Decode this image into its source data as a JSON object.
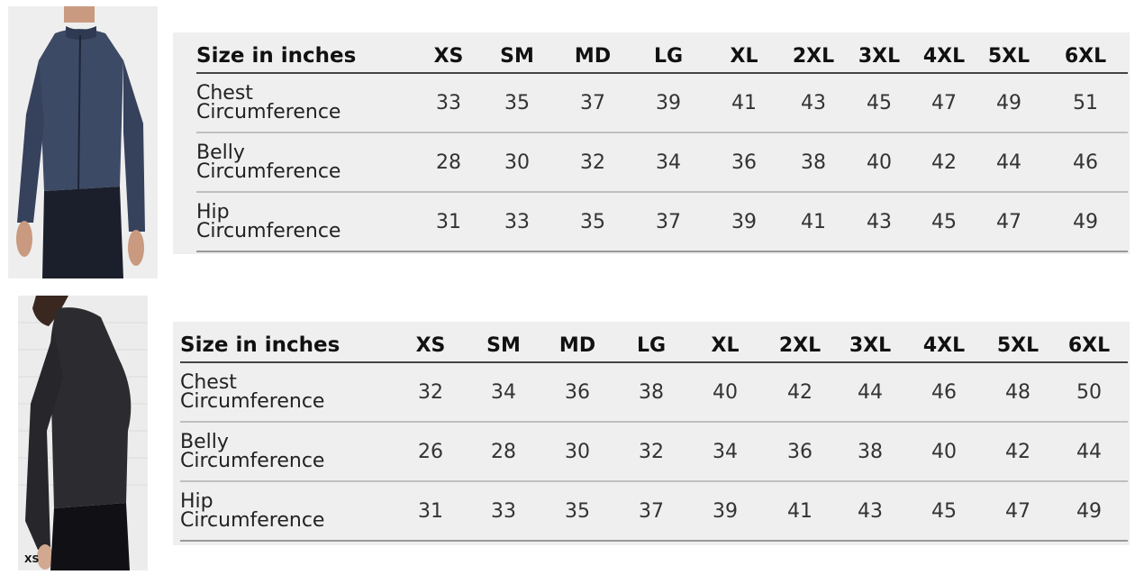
{
  "men_chart": {
    "photo": {
      "name": "mens-long-sleeve-jersey"
    },
    "header": {
      "label": "Size in inches",
      "sizes": [
        "XS",
        "SM",
        "MD",
        "LG",
        "XL",
        "2XL",
        "3XL",
        "4XL",
        "5XL",
        "6XL"
      ]
    },
    "rows": [
      {
        "label_line1": "Chest",
        "label_line2": "Circumference",
        "values": [
          "33",
          "35",
          "37",
          "39",
          "41",
          "43",
          "45",
          "47",
          "49",
          "51"
        ]
      },
      {
        "label_line1": "Belly",
        "label_line2": "Circumference",
        "values": [
          "28",
          "30",
          "32",
          "34",
          "36",
          "38",
          "40",
          "42",
          "44",
          "46"
        ]
      },
      {
        "label_line1": "Hip",
        "label_line2": "Circumference",
        "values": [
          "31",
          "33",
          "35",
          "37",
          "39",
          "41",
          "43",
          "45",
          "47",
          "49"
        ]
      }
    ]
  },
  "women_chart": {
    "photo": {
      "name": "womens-long-sleeve-jersey",
      "size_tag": "XS"
    },
    "header": {
      "label": "Size in inches",
      "sizes": [
        "XS",
        "SM",
        "MD",
        "LG",
        "XL",
        "2XL",
        "3XL",
        "4XL",
        "5XL",
        "6XL"
      ]
    },
    "rows": [
      {
        "label_line1": "Chest",
        "label_line2": "Circumference",
        "values": [
          "32",
          "34",
          "36",
          "38",
          "40",
          "42",
          "44",
          "46",
          "48",
          "50"
        ]
      },
      {
        "label_line1": "Belly",
        "label_line2": "Circumference",
        "values": [
          "26",
          "28",
          "30",
          "32",
          "34",
          "36",
          "38",
          "40",
          "42",
          "44"
        ]
      },
      {
        "label_line1": "Hip",
        "label_line2": "Circumference",
        "values": [
          "31",
          "33",
          "35",
          "37",
          "39",
          "41",
          "43",
          "45",
          "47",
          "49"
        ]
      }
    ]
  }
}
